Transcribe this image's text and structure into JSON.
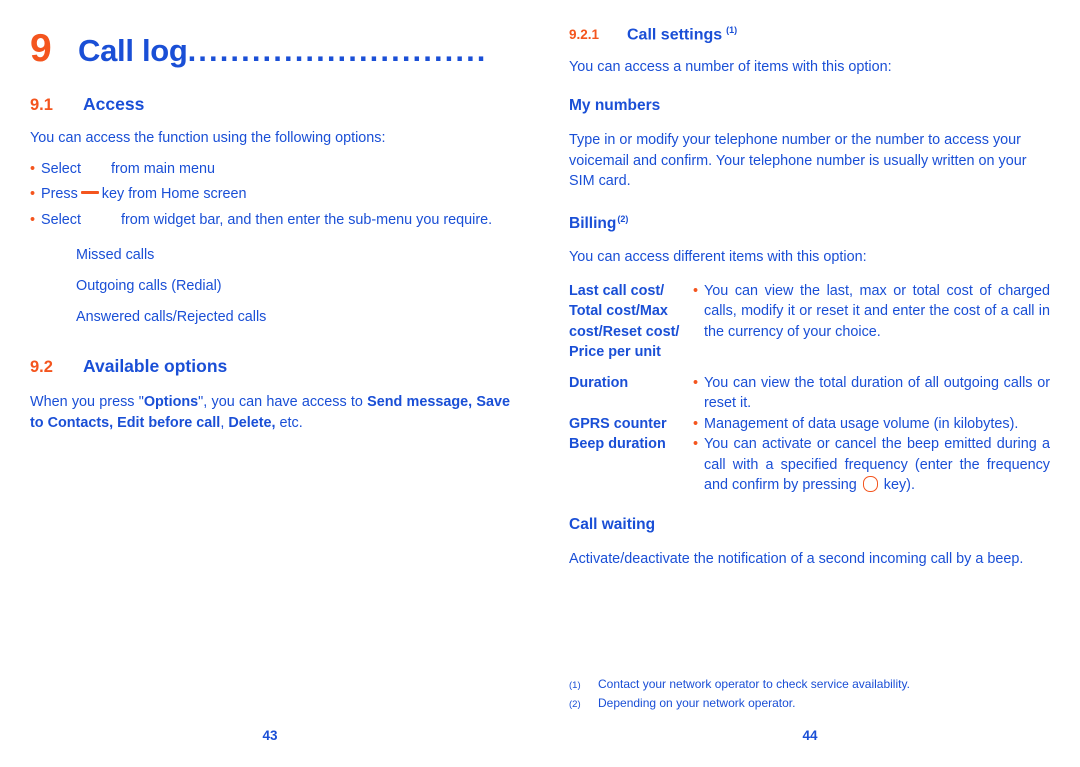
{
  "colors": {
    "blue": "#1A4FD6",
    "orange": "#F4551E"
  },
  "left_page": {
    "chapter": {
      "number": "9",
      "title": "Call log",
      "leader": "............................"
    },
    "section_9_1": {
      "number": "9.1",
      "title": "Access",
      "intro": "You can access the function using the following options:",
      "bullets": [
        {
          "bullet": "•",
          "before": "Select",
          "icon": "menu-icon-placeholder",
          "after": "from main menu"
        },
        {
          "bullet": "•",
          "before": "Press",
          "icon": "dash-key-icon",
          "after": "key from Home screen"
        },
        {
          "bullet": "•",
          "before": "Select",
          "icon": "widget-icon-placeholder",
          "after": "from widget bar, and then enter the sub-menu you require."
        }
      ],
      "subitems": [
        "Missed calls",
        "Outgoing calls (Redial)",
        "Answered calls/Rejected calls"
      ]
    },
    "section_9_2": {
      "number": "9.2",
      "title": "Available options",
      "paragraph": {
        "p1": "When you press \"",
        "b1": "Options",
        "p2": "\", you can have access to ",
        "b2": "Send message, Save to Contacts, Edit before call",
        "p3": ", ",
        "b3": "Delete,",
        "p4": " etc."
      }
    },
    "page_number": "43"
  },
  "right_page": {
    "section_9_2_1": {
      "number": "9.2.1",
      "title": "Call settings",
      "footnote_mark": "(1)",
      "intro": "You can access a number of items with this option:"
    },
    "my_numbers": {
      "heading": "My numbers",
      "body": "Type in or modify your telephone number or the number to access your voicemail and confirm. Your telephone number is usually written on your SIM card."
    },
    "billing": {
      "heading": "Billing",
      "footnote_mark": "(2)",
      "intro": "You can access different items with this option:",
      "rows": [
        {
          "term_lines": [
            "Last call cost/",
            "Total cost/Max",
            "cost/Reset cost/",
            "Price per unit"
          ],
          "bullet": "•",
          "description": "You can view the last, max or total cost of charged calls, modify it or reset it and enter the cost of a call in the currency of your choice."
        },
        {
          "term_lines": [
            "Duration"
          ],
          "bullet": "•",
          "description": "You can view the total duration of all outgoing calls or reset it."
        },
        {
          "term_lines": [
            "GPRS counter"
          ],
          "bullet": "•",
          "description": "Management of data usage volume (in kilobytes)."
        },
        {
          "term_lines": [
            "Beep duration"
          ],
          "bullet": "•",
          "description_part1": "You can activate or cancel the beep emitted during a call with a specified frequency (enter the frequency and confirm by pressing",
          "key_icon": "ok-round-key-icon",
          "description_part2": "key)."
        }
      ]
    },
    "call_waiting": {
      "heading": "Call waiting",
      "body": "Activate/deactivate the notification of a second incoming call by a beep."
    },
    "footnotes": [
      {
        "mark": "(1)",
        "text": "Contact your network operator to check service availability."
      },
      {
        "mark": "(2)",
        "text": "Depending on your network operator."
      }
    ],
    "page_number": "44"
  }
}
